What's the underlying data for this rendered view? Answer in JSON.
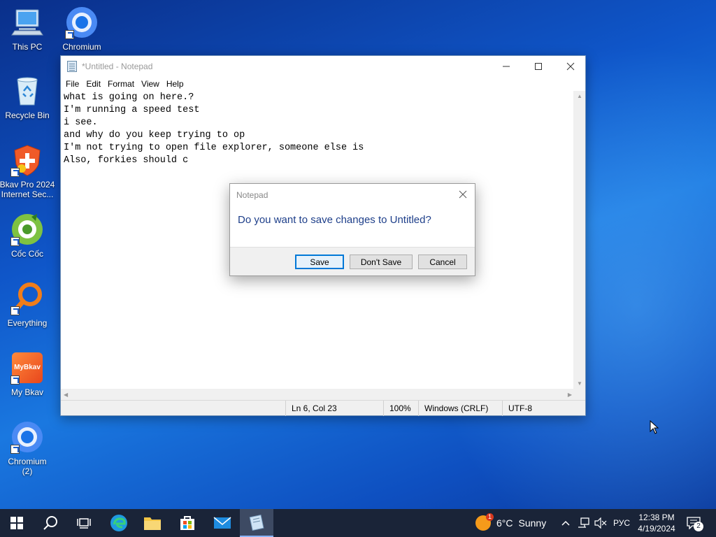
{
  "desktop": {
    "icons": [
      {
        "label": "This PC"
      },
      {
        "label": "Chromium"
      },
      {
        "label": "Recycle Bin"
      },
      {
        "label": "Bkav Pro 2024 Internet Sec..."
      },
      {
        "label": "Cốc Cốc"
      },
      {
        "label": "Everything"
      },
      {
        "label": "My Bkav"
      },
      {
        "label": "Chromium (2)"
      }
    ],
    "mybkav_logo_text": "MyBkav"
  },
  "notepad": {
    "title": "*Untitled - Notepad",
    "menu": [
      "File",
      "Edit",
      "Format",
      "View",
      "Help"
    ],
    "lines": [
      "what is going on here.?",
      "I'm running a speed test",
      "i see.",
      "and why do you keep trying to op",
      "I'm not trying to open file explorer, someone else is",
      "Also, forkies should c"
    ],
    "status": {
      "position": "Ln 6, Col 23",
      "zoom": "100%",
      "line_ending": "Windows (CRLF)",
      "encoding": "UTF-8"
    }
  },
  "dialog": {
    "title": "Notepad",
    "message": "Do you want to save changes to Untitled?",
    "save_label": "Save",
    "dont_save_label": "Don't Save",
    "cancel_label": "Cancel"
  },
  "taskbar": {
    "weather_temp": "6°C",
    "weather_desc": "Sunny",
    "weather_badge": "1",
    "language": "РУС",
    "time": "12:38 PM",
    "date": "4/19/2024",
    "notification_count": "2"
  },
  "colors": {
    "accent": "#0078d7",
    "taskbar": "#1a2438",
    "dialog_text": "#1e3f8a"
  }
}
